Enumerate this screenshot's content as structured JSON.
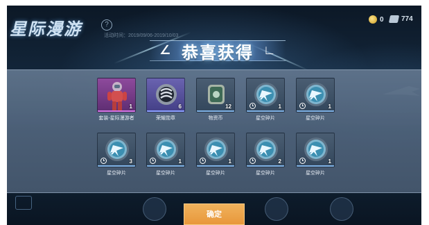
{
  "header": {
    "event_title": "星际漫游",
    "event_date": "活动时间：2019/09/06-2019/10/03",
    "gold_amount": "0",
    "ticket_amount": "774"
  },
  "popup": {
    "title": "恭喜获得",
    "confirm_label": "确定",
    "items": [
      {
        "name": "套装-星际漫游者",
        "count": "1",
        "icon": "astronaut-suit-icon",
        "timed": false,
        "rarity": "purple"
      },
      {
        "name": "荣耀勋章",
        "count": "6",
        "icon": "honor-medal-icon",
        "timed": false,
        "rarity": "blue"
      },
      {
        "name": "物资币",
        "count": "12",
        "icon": "supply-coin-icon",
        "timed": false,
        "rarity": "normal"
      },
      {
        "name": "星空碎片",
        "count": "1",
        "icon": "star-fragment-icon",
        "timed": true,
        "rarity": "normal"
      },
      {
        "name": "星空碎片",
        "count": "1",
        "icon": "star-fragment-icon",
        "timed": true,
        "rarity": "normal"
      },
      {
        "name": "星空碎片",
        "count": "3",
        "icon": "star-fragment-icon",
        "timed": true,
        "rarity": "normal"
      },
      {
        "name": "星空碎片",
        "count": "1",
        "icon": "star-fragment-icon",
        "timed": true,
        "rarity": "normal"
      },
      {
        "name": "星空碎片",
        "count": "1",
        "icon": "star-fragment-icon",
        "timed": true,
        "rarity": "normal"
      },
      {
        "name": "星空碎片",
        "count": "2",
        "icon": "star-fragment-icon",
        "timed": true,
        "rarity": "normal"
      },
      {
        "name": "星空碎片",
        "count": "1",
        "icon": "star-fragment-icon",
        "timed": true,
        "rarity": "normal"
      }
    ]
  },
  "colors": {
    "confirm_button": "#e8973b",
    "popup_band": "#5a7290",
    "title_glow": "#96d2ff"
  }
}
